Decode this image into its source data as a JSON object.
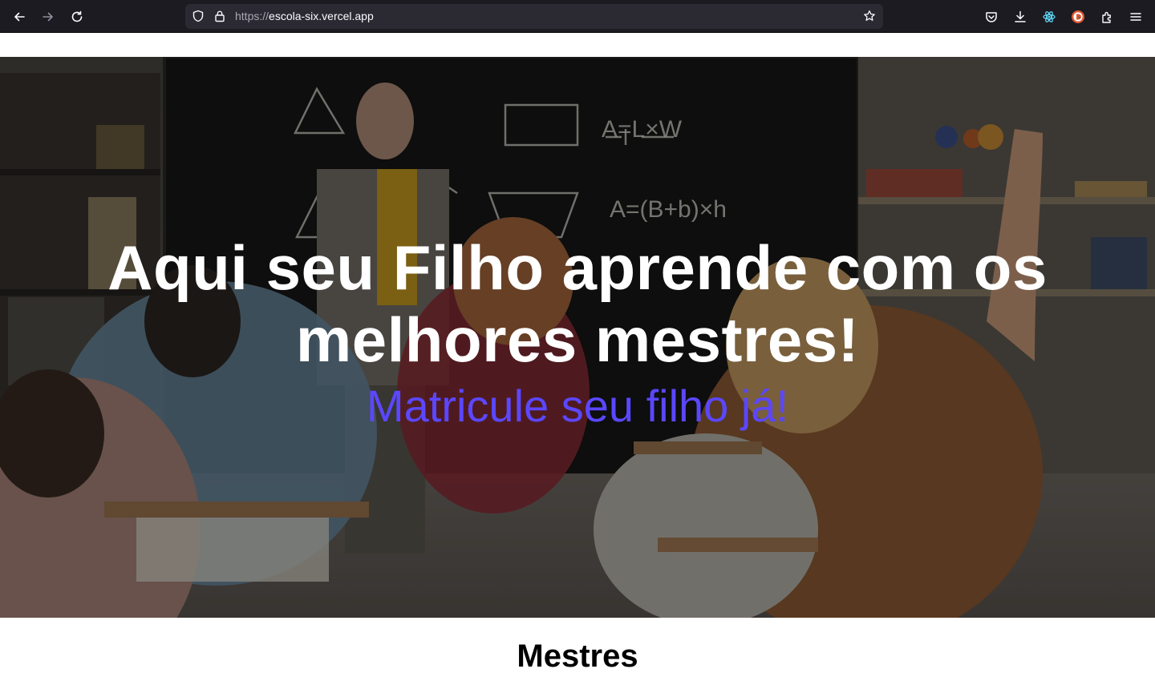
{
  "browser": {
    "url_protocol": "https://",
    "url_host": "escola-six.vercel.app",
    "icons": [
      "back-arrow-icon",
      "forward-arrow-icon",
      "reload-icon",
      "shield-icon",
      "lock-icon",
      "star-icon",
      "pocket-icon",
      "download-icon",
      "react-devtools-icon",
      "duckduckgo-icon",
      "extensions-icon",
      "menu-icon"
    ]
  },
  "hero": {
    "title": "Aqui seu Filho aprende com os melhores mestres!",
    "subtitle": "Matricule seu filho já!",
    "subtitle_color": "#5b47ff"
  },
  "sections": {
    "teachers_title": "Mestres"
  }
}
